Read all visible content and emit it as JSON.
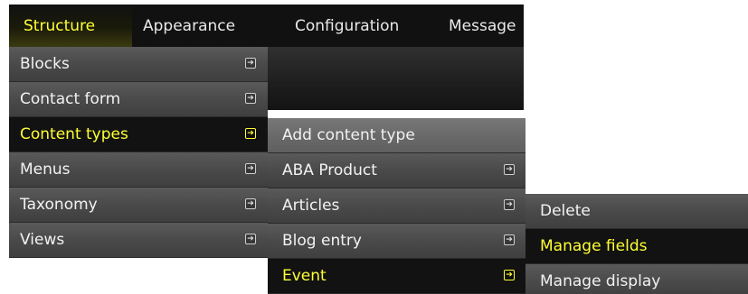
{
  "topnav": {
    "items": [
      {
        "label": "Structure",
        "active": true
      },
      {
        "label": "Appearance"
      },
      {
        "label": "Configuration"
      },
      {
        "label": "Message"
      }
    ]
  },
  "structure_menu": {
    "items": [
      {
        "label": "Blocks"
      },
      {
        "label": "Contact form"
      },
      {
        "label": "Content types",
        "active": true
      },
      {
        "label": "Menus"
      },
      {
        "label": "Taxonomy"
      },
      {
        "label": "Views"
      }
    ]
  },
  "content_types_menu": {
    "items": [
      {
        "label": "Add content type"
      },
      {
        "label": "ABA Product"
      },
      {
        "label": "Articles"
      },
      {
        "label": "Blog entry"
      },
      {
        "label": "Event",
        "active": true
      }
    ]
  },
  "event_menu": {
    "items": [
      {
        "label": "Delete"
      },
      {
        "label": "Manage fields",
        "active": true
      },
      {
        "label": "Manage display"
      }
    ]
  },
  "icons": {
    "submenu_arrow": "submenu-arrow-icon"
  },
  "colors": {
    "active_text": "#ffff33",
    "menu_bg": "#4a4a4a",
    "active_bg": "#121212",
    "topbar_bg": "#111111"
  }
}
